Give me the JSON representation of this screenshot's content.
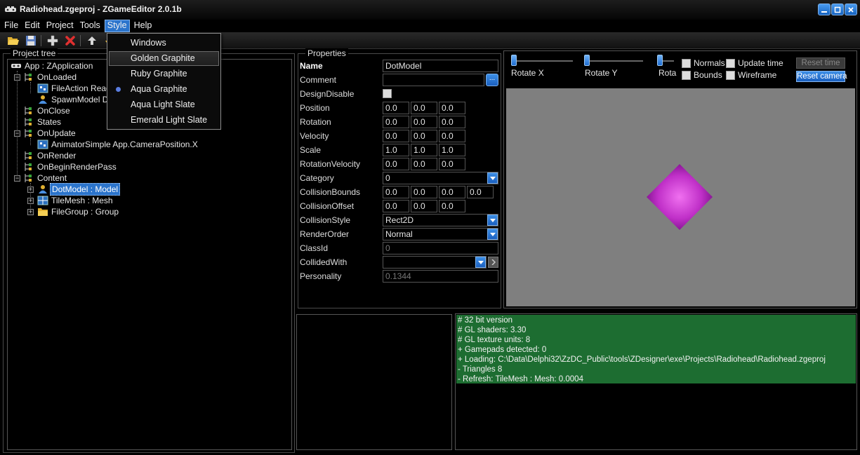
{
  "window": {
    "title": "Radiohead.zgeproj - ZGameEditor 2.0.1b"
  },
  "menu": {
    "file": "File",
    "edit": "Edit",
    "project": "Project",
    "tools": "Tools",
    "style": "Style",
    "help": "Help"
  },
  "style_menu": {
    "options": [
      "Windows",
      "Golden Graphite",
      "Ruby Graphite",
      "Aqua Graphite",
      "Aqua Light Slate",
      "Emerald Light Slate"
    ],
    "hovered": "Golden Graphite",
    "selected": "Aqua Graphite"
  },
  "project_tree": {
    "label": "Project tree",
    "nodes": [
      {
        "text": "App : ZApplication"
      },
      {
        "text": "OnLoaded"
      },
      {
        "text": "FileAction  Read"
      },
      {
        "text": "SpawnModel  Do"
      },
      {
        "text": "OnClose"
      },
      {
        "text": "States"
      },
      {
        "text": "OnUpdate"
      },
      {
        "text": "AnimatorSimple  App.CameraPosition.X"
      },
      {
        "text": "OnRender"
      },
      {
        "text": "OnBeginRenderPass"
      },
      {
        "text": "Content"
      },
      {
        "text": "DotModel : Model"
      },
      {
        "text": "TileMesh : Mesh"
      },
      {
        "text": "FileGroup : Group"
      }
    ]
  },
  "properties": {
    "label": "Properties",
    "name_label": "Name",
    "name_value": "DotModel",
    "comment_label": "Comment",
    "comment_value": "",
    "ellipsis": "...",
    "design_disable_label": "DesignDisable",
    "position_label": "Position",
    "position": [
      "0.0",
      "0.0",
      "0.0"
    ],
    "rotation_label": "Rotation",
    "rotation": [
      "0.0",
      "0.0",
      "0.0"
    ],
    "velocity_label": "Velocity",
    "velocity": [
      "0.0",
      "0.0",
      "0.0"
    ],
    "scale_label": "Scale",
    "scale": [
      "1.0",
      "1.0",
      "1.0"
    ],
    "rotation_velocity_label": "RotationVelocity",
    "rotation_velocity": [
      "0.0",
      "0.0",
      "0.0"
    ],
    "category_label": "Category",
    "category_value": "0",
    "collision_bounds_label": "CollisionBounds",
    "collision_bounds": [
      "0.0",
      "0.0",
      "0.0",
      "0.0"
    ],
    "collision_offset_label": "CollisionOffset",
    "collision_offset": [
      "0.0",
      "0.0",
      "0.0"
    ],
    "collision_style_label": "CollisionStyle",
    "collision_style_value": "Rect2D",
    "render_order_label": "RenderOrder",
    "render_order_value": "Normal",
    "class_id_label": "ClassId",
    "class_id_value": "0",
    "collided_with_label": "CollidedWith",
    "collided_with_value": "",
    "personality_label": "Personality",
    "personality_value": "0.1344"
  },
  "preview": {
    "rotate_x": "Rotate X",
    "rotate_y": "Rotate Y",
    "rota": "Rota",
    "normals": "Normals",
    "bounds": "Bounds",
    "update_time": "Update time",
    "wireframe": "Wireframe",
    "reset_time": "Reset time",
    "reset_camera": "Reset camera",
    "background_color": "#7f7f7f",
    "model_color": "#d040d0"
  },
  "log": {
    "lines": [
      "# 32 bit version",
      "# GL shaders: 3.30",
      "# GL texture units: 8",
      "+ Gamepads detected: 0",
      "+ Loading: C:\\Data\\Delphi32\\ZzDC_Public\\tools\\ZDesigner\\exe\\Projects\\Radiohead\\Radiohead.zgeproj",
      "-  Triangles 8",
      "-  Refresh: TileMesh : Mesh: 0.0004"
    ],
    "background_color": "#1d6d31"
  },
  "colors": {
    "accent": "#2b74cc",
    "background": "#000000"
  }
}
